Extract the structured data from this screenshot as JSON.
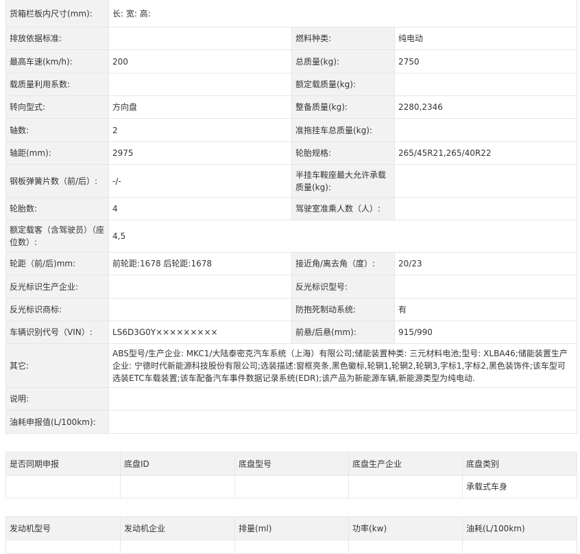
{
  "spec": {
    "cargo_box_label": "货箱栏板内尺寸(mm):",
    "cargo_box_value": "长:  宽:  高:",
    "rows": [
      {
        "l1": "排放依据标准:",
        "v1": "",
        "l2": "燃料种类:",
        "v2": "纯电动"
      },
      {
        "l1": "最高车速(km/h):",
        "v1": "200",
        "l2": "总质量(kg):",
        "v2": "2750"
      },
      {
        "l1": "载质量利用系数:",
        "v1": "",
        "l2": "额定载质量(kg):",
        "v2": ""
      },
      {
        "l1": "转向型式:",
        "v1": "方向盘",
        "l2": "整备质量(kg):",
        "v2": "2280,2346"
      },
      {
        "l1": "轴数:",
        "v1": "2",
        "l2": "准拖挂车总质量(kg):",
        "v2": ""
      },
      {
        "l1": "轴距(mm):",
        "v1": "2975",
        "l2": "轮胎规格:",
        "v2": "265/45R21,265/40R22"
      },
      {
        "l1": "钢板弹簧片数（前/后）:",
        "v1": "-/-",
        "l2": "半挂车鞍座最大允许承载质量(kg):",
        "v2": ""
      },
      {
        "l1": "轮胎数:",
        "v1": "4",
        "l2": "驾驶室准乘人数（人）:",
        "v2": ""
      }
    ],
    "rated_passengers_label": "额定载客（含驾驶员）（座位数）:",
    "rated_passengers_value": "4,5",
    "rows2": [
      {
        "l1": "轮距（前/后)mm:",
        "v1": "前轮距:1678 后轮距:1678",
        "l2": "接近角/离去角（度）:",
        "v2": "20/23"
      },
      {
        "l1": "反光标识生产企业:",
        "v1": "",
        "l2": "反光标识型号:",
        "v2": ""
      },
      {
        "l1": "反光标识商标:",
        "v1": "",
        "l2": "防抱死制动系统:",
        "v2": "有"
      },
      {
        "l1": "车辆识别代号（VIN）:",
        "v1": "LS6D3G0Y×××××××××",
        "l2": "前悬/后悬(mm):",
        "v2": "915/990"
      }
    ],
    "other_label": "其它:",
    "other_value": "ABS型号/生产企业: MKC1/大陆泰密克汽车系统（上海）有限公司;储能装置种类: 三元材料电池;型号: XLBA46;储能装置生产企业: 宁德时代新能源科技股份有限公司;选装描述:窗框亮条,黑色徽标,轮辋1,轮辋2,轮辋3,字标1,字标2,黑色装饰件;该车型可选装ETC车载装置;该车配备汽车事件数据记录系统(EDR);该产品为新能源车辆,新能源类型为纯电动.",
    "note_label": "说明:",
    "note_value": "",
    "fuel_label": "油耗申报值(L/100km):",
    "fuel_value": ""
  },
  "chassis": {
    "headers": [
      "是否同期申报",
      "底盘ID",
      "底盘型号",
      "底盘生产企业",
      "底盘类别"
    ],
    "row": [
      "",
      "",
      "",
      "",
      "承载式车身"
    ]
  },
  "engine": {
    "headers": [
      "发动机型号",
      "发动机企业",
      "排量(ml)",
      "功率(kw)",
      "油耗(L/100km)"
    ]
  }
}
